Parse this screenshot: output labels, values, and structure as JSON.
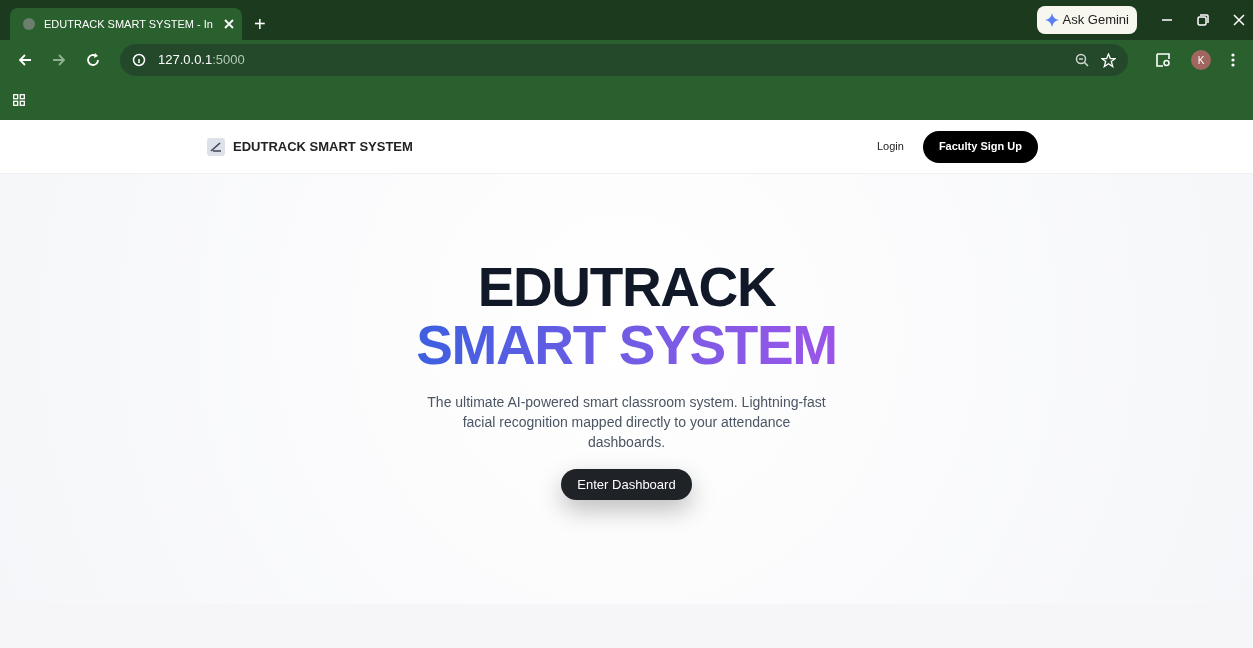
{
  "browser": {
    "tab": {
      "title": "EDUTRACK SMART SYSTEM - In",
      "selected": true
    },
    "new_tab": "+",
    "ask_gemini": "Ask Gemini",
    "url_host": "127.0.0.1",
    "url_port": ":5000",
    "profile_initial": "K"
  },
  "nav": {
    "brand": "EDUTRACK SMART SYSTEM",
    "login": "Login",
    "signup": "Faculty Sign Up"
  },
  "hero": {
    "title_line1": "EDUTRACK",
    "title_line2": "SMART SYSTEM",
    "description": "The ultimate AI-powered smart classroom system. Lightning-fast facial recognition mapped directly to your attendance dashboards.",
    "cta": "Enter Dashboard"
  }
}
